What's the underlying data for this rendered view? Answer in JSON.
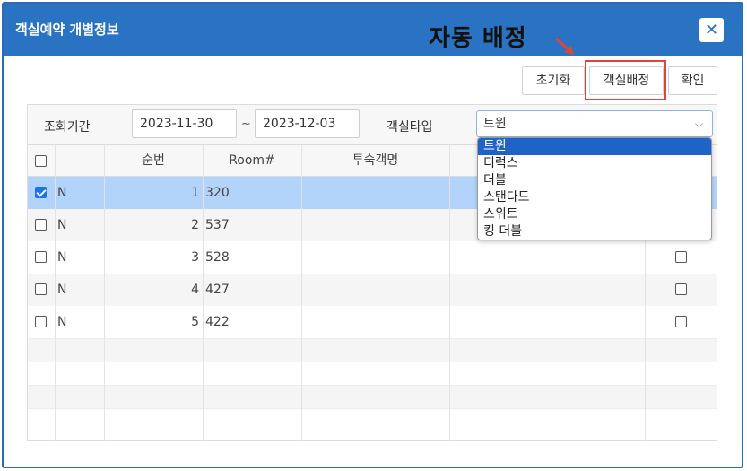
{
  "dialog": {
    "title": "객실예약 개별정보",
    "close_label": "✕"
  },
  "annotation": {
    "text": "자동 배정"
  },
  "toolbar": {
    "reset_label": "초기화",
    "assign_label": "객실배정",
    "confirm_label": "확인"
  },
  "filter": {
    "period_label": "조회기간",
    "start_date": "2023-11-30",
    "separator": "~",
    "end_date": "2023-12-03",
    "room_type_label": "객실타입",
    "room_type_value": "트윈"
  },
  "room_type_options": [
    "트윈",
    "디럭스",
    "더블",
    "스탠다드",
    "스위트",
    "킹 더블"
  ],
  "table": {
    "headers": {
      "seq": "순번",
      "room": "Room#",
      "guest": "투숙객명"
    },
    "rows": [
      {
        "flag": "N",
        "seq": "1",
        "room": "320",
        "checked": true
      },
      {
        "flag": "N",
        "seq": "2",
        "room": "537",
        "checked": false
      },
      {
        "flag": "N",
        "seq": "3",
        "room": "528",
        "checked": false
      },
      {
        "flag": "N",
        "seq": "4",
        "room": "427",
        "checked": false
      },
      {
        "flag": "N",
        "seq": "5",
        "room": "422",
        "checked": false
      }
    ]
  },
  "colors": {
    "header_blue": "#2a73c2",
    "selected_row": "#b3d4fa",
    "highlight_red": "#e0453a",
    "option_active": "#1f63c6"
  },
  "icons": {
    "close": "close-icon",
    "arrow": "red-arrow-icon",
    "caret": "chevron-down-icon"
  }
}
